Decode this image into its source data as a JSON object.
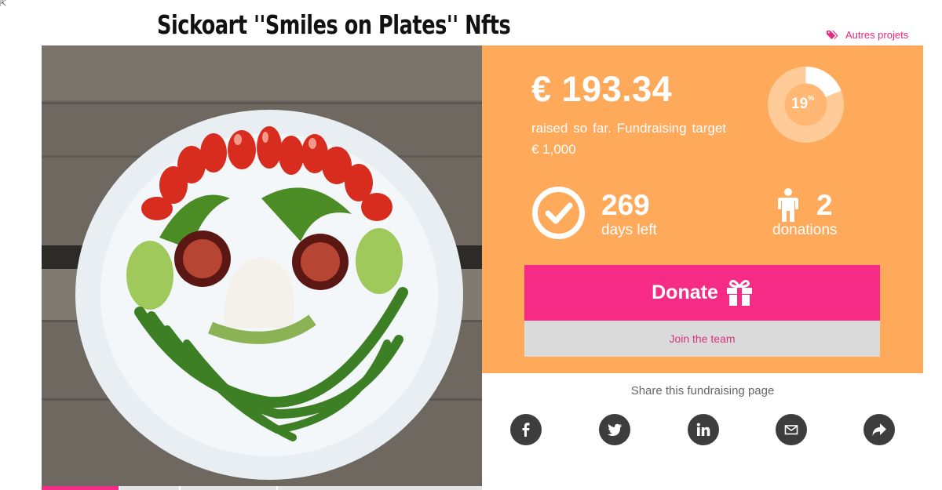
{
  "cursor_glyph": "⇱",
  "title": "Sickoart ''Smiles on Plates'' Nfts",
  "other_projects": {
    "label": "Autres projets",
    "icon": "tags-icon"
  },
  "campaign": {
    "amount_raised": "€ 193.34",
    "raised_text": "raised so far. Fundraising target € 1,000",
    "percent_value": 19,
    "percent_text": "19",
    "percent_sign": "%",
    "days_left": "269",
    "days_label": "days left",
    "donations": "2",
    "donations_label": "donations"
  },
  "actions": {
    "donate_label": "Donate",
    "join_label": "Join the team"
  },
  "share": {
    "label": "Share this fundraising page",
    "buttons": [
      "facebook-icon",
      "twitter-icon",
      "linkedin-icon",
      "email-icon",
      "share-arrow-icon"
    ]
  },
  "colors": {
    "panel": "#ffa95b",
    "accent_pink": "#f52b86",
    "join_bg": "#dadada",
    "share_icons": "#3d3d3d"
  }
}
